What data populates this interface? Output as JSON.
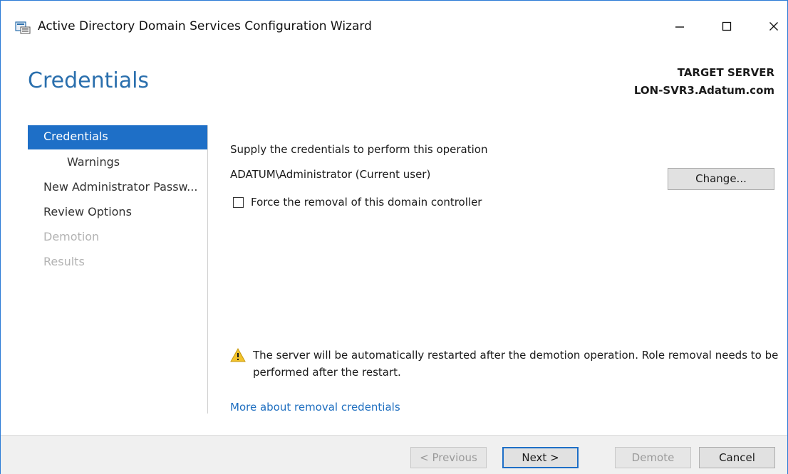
{
  "window": {
    "title": "Active Directory Domain Services Configuration Wizard",
    "icon": "server-wizard-icon",
    "controls": [
      "minimize-icon",
      "maximize-icon",
      "close-icon"
    ],
    "accent_color": "#1e6fc7"
  },
  "header": {
    "page_title": "Credentials",
    "target_label": "TARGET SERVER",
    "target_name": "LON-SVR3.Adatum.com"
  },
  "nav": {
    "items": [
      {
        "label": "Credentials",
        "state": "active"
      },
      {
        "label": "Warnings",
        "state": "normal"
      },
      {
        "label": "New Administrator Passw...",
        "state": "normal"
      },
      {
        "label": "Review Options",
        "state": "normal"
      },
      {
        "label": "Demotion",
        "state": "disabled"
      },
      {
        "label": "Results",
        "state": "disabled"
      }
    ]
  },
  "main": {
    "supply_text": "Supply the credentials to perform this operation",
    "current_user": "ADATUM\\Administrator (Current user)",
    "change_button": "Change...",
    "force_removal_label": "Force the removal of this domain controller",
    "force_removal_checked": false,
    "warning_text": "The server will be automatically restarted after the demotion operation. Role removal needs to be performed after the restart.",
    "warning_icon": "warning-icon",
    "more_link": "More about removal credentials"
  },
  "footer": {
    "previous": "< Previous",
    "next": "Next >",
    "demote": "Demote",
    "cancel": "Cancel"
  }
}
